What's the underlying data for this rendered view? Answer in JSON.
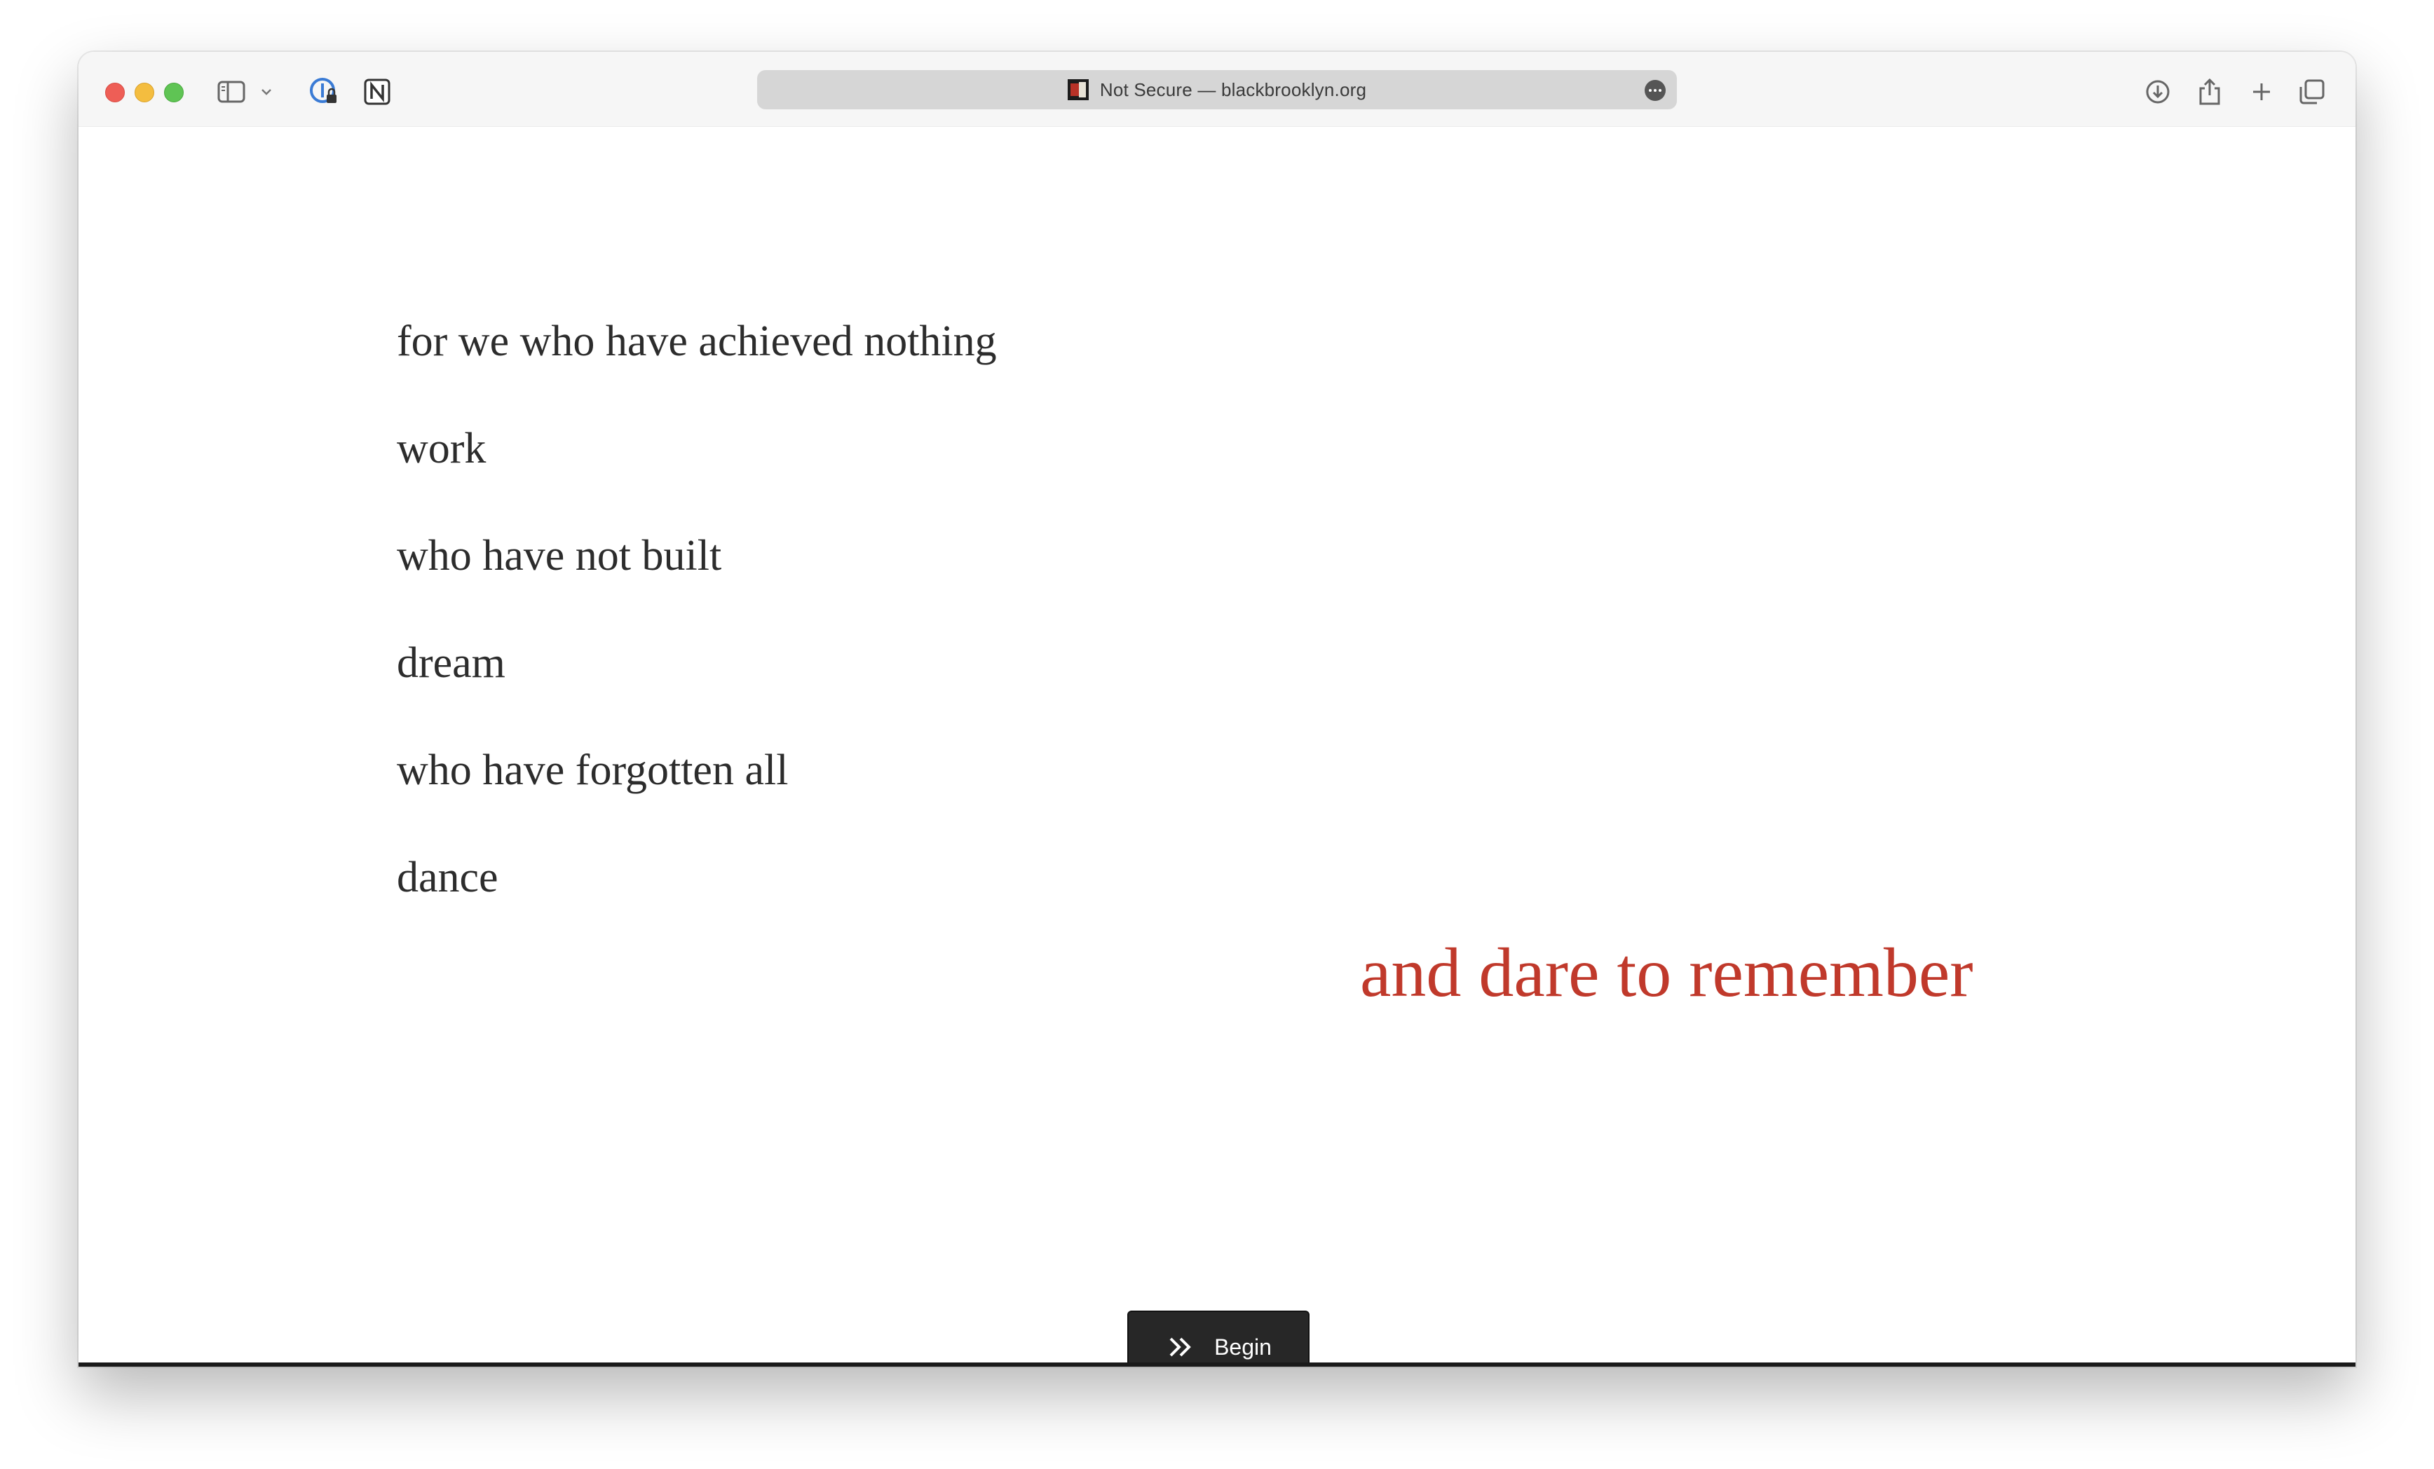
{
  "browser": {
    "address_bar": {
      "security_label": "Not Secure",
      "separator": "—",
      "domain": "blackbrooklyn.org",
      "display_text": "Not Secure — blackbrooklyn.org"
    },
    "toolbar_icons": [
      "sidebar-icon",
      "chevron-down-icon",
      "password-manager-icon",
      "notion-icon",
      "download-icon",
      "share-icon",
      "new-tab-icon",
      "tab-overview-icon"
    ]
  },
  "page": {
    "poem_lines": [
      "for we who have achieved nothing",
      "work",
      "who have not built",
      "dream",
      "who have forgotten all",
      "dance"
    ],
    "highlight": "and dare to remember",
    "begin_button": {
      "label": "Begin",
      "icon": "double-chevron-right-icon"
    }
  },
  "colors": {
    "text": "#2c2c2c",
    "accent": "#c0392b",
    "button_bg": "#272727"
  }
}
